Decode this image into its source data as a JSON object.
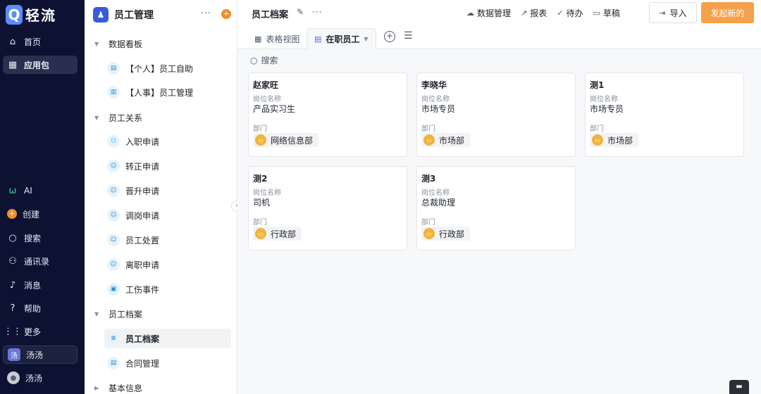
{
  "app": {
    "logo_letter": "Q",
    "name": "轻流"
  },
  "rail": {
    "top": [
      {
        "label": "首页",
        "icon": "home-icon",
        "glyph": "⌂"
      },
      {
        "label": "应用包",
        "icon": "apps-icon",
        "glyph": "▦"
      }
    ],
    "bottom": [
      {
        "label": "AI",
        "icon": "ai-icon",
        "glyph": "ω"
      },
      {
        "label": "创建",
        "icon": "plus-circle-icon",
        "glyph": "+"
      },
      {
        "label": "搜索",
        "icon": "search-icon",
        "glyph": "⌕"
      },
      {
        "label": "通讯录",
        "icon": "contacts-icon",
        "glyph": "⚇"
      },
      {
        "label": "消息",
        "icon": "bell-icon",
        "glyph": "♫"
      },
      {
        "label": "帮助",
        "icon": "help-icon",
        "glyph": "?"
      },
      {
        "label": "更多",
        "icon": "grid-icon",
        "glyph": "⋮⋮"
      },
      {
        "label": "汤汤",
        "icon": "workspace-icon",
        "glyph": "汤"
      },
      {
        "label": "汤汤",
        "icon": "avatar-icon",
        "glyph": "◉"
      }
    ]
  },
  "sidebar": {
    "title": "员工管理",
    "groups": [
      {
        "label": "数据看板",
        "items": [
          "【个人】员工自助",
          "【人事】员工管理"
        ]
      },
      {
        "label": "员工关系",
        "items": [
          "入职申请",
          "转正申请",
          "晋升申请",
          "调岗申请",
          "员工处置",
          "离职申请",
          "工伤事件"
        ]
      },
      {
        "label": "员工档案",
        "items": [
          "员工档案",
          "合同管理"
        ]
      },
      {
        "label": "基本信息",
        "items": []
      }
    ]
  },
  "header": {
    "title": "员工档案",
    "actions": [
      "数据管理",
      "报表",
      "待办",
      "草稿"
    ],
    "import_label": "导入",
    "new_label": "发起新的"
  },
  "tabs": {
    "table_view": "表格视图",
    "active": "在职员工"
  },
  "search": {
    "label": "搜索"
  },
  "cards": [
    {
      "name": "赵家旺",
      "position_label": "岗位名称",
      "position": "产品实习生",
      "dept_label": "部门",
      "dept": "网络信息部"
    },
    {
      "name": "李晓华",
      "position_label": "岗位名称",
      "position": "市场专员",
      "dept_label": "部门",
      "dept": "市场部"
    },
    {
      "name": "测1",
      "position_label": "岗位名称",
      "position": "市场专员",
      "dept_label": "部门",
      "dept": "市场部"
    },
    {
      "name": "测2",
      "position_label": "岗位名称",
      "position": "司机",
      "dept_label": "部门",
      "dept": "行政部"
    },
    {
      "name": "测3",
      "position_label": "岗位名称",
      "position": "总裁助理",
      "dept_label": "部门",
      "dept": "行政部"
    }
  ],
  "colors": {
    "rail_bg": "#0d1233",
    "accent_orange": "#f5a04b",
    "brand_blue": "#5b8cff"
  }
}
